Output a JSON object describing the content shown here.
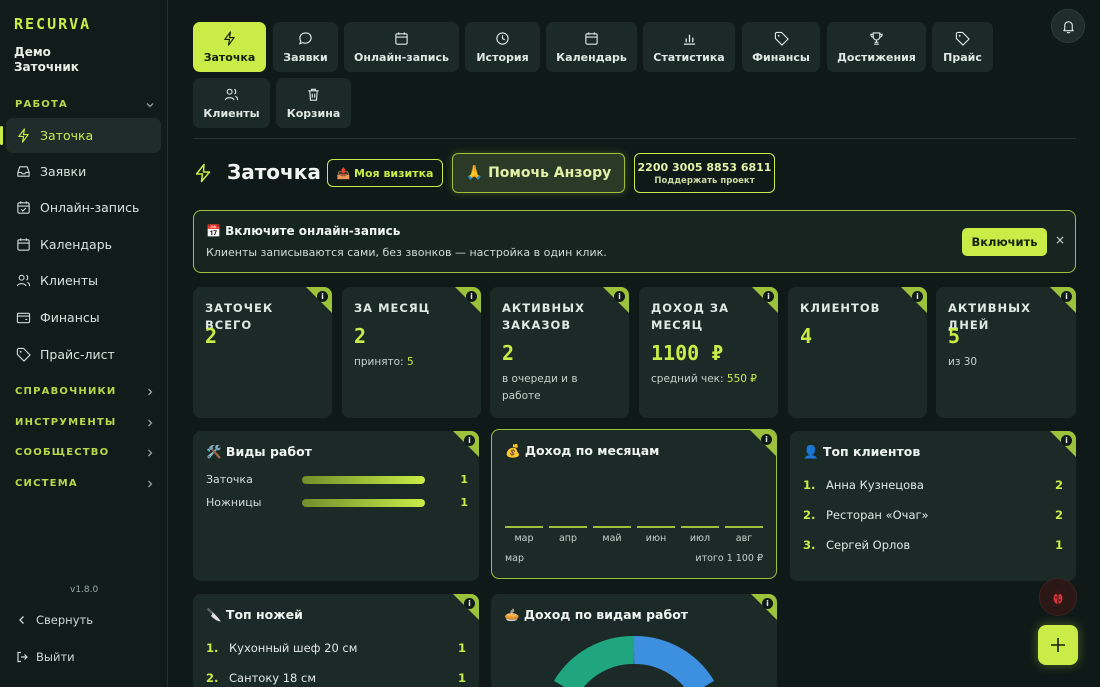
{
  "app": {
    "logo": "RECURVA",
    "user_line1": "Демо",
    "user_line2": "Заточник",
    "version": "v1.8.0"
  },
  "sidebar": {
    "section_work": "РАБОТА",
    "items": [
      {
        "label": "Заточка",
        "icon": "bolt-icon"
      },
      {
        "label": "Заявки",
        "icon": "inbox-icon"
      },
      {
        "label": "Онлайн-запись",
        "icon": "calendar-check-icon"
      },
      {
        "label": "Календарь",
        "icon": "calendar-icon"
      },
      {
        "label": "Клиенты",
        "icon": "users-icon"
      },
      {
        "label": "Финансы",
        "icon": "wallet-icon"
      },
      {
        "label": "Прайс-лист",
        "icon": "tag-icon"
      }
    ],
    "sections": [
      "СПРАВОЧНИКИ",
      "ИНСТРУМЕНТЫ",
      "СООБЩЕСТВО",
      "СИСТЕМА"
    ],
    "collapse": "Свернуть",
    "logout": "Выйти"
  },
  "tabs": [
    {
      "label": "Заточка",
      "icon": "bolt-icon"
    },
    {
      "label": "Заявки",
      "icon": "chat-icon"
    },
    {
      "label": "Онлайн-запись",
      "icon": "calendar-icon"
    },
    {
      "label": "История",
      "icon": "clock-icon"
    },
    {
      "label": "Календарь",
      "icon": "calendar-icon"
    },
    {
      "label": "Статистика",
      "icon": "bar-chart-icon"
    },
    {
      "label": "Финансы",
      "icon": "tag-icon"
    },
    {
      "label": "Достижения",
      "icon": "trophy-icon"
    },
    {
      "label": "Прайс",
      "icon": "tag-icon"
    },
    {
      "label": "Клиенты",
      "icon": "users-icon"
    },
    {
      "label": "Корзина",
      "icon": "trash-icon"
    }
  ],
  "header": {
    "title": "Заточка",
    "card_btn": "📤 Моя визитка",
    "help_btn": "🙏 Помочь Анзору",
    "support_number": "2200 3005 8853 6811",
    "support_label": "Поддержать проект"
  },
  "banner": {
    "title": "📅 Включите онлайн-запись",
    "text": "Клиенты записываются сами, без звонков — настройка в один клик.",
    "button": "Включить",
    "close": "×"
  },
  "stats": [
    {
      "label": "ЗАТОЧЕК ВСЕГО",
      "value": "2",
      "sub_text": "",
      "sub_value": ""
    },
    {
      "label": "ЗА МЕСЯЦ",
      "value": "2",
      "sub_text": "принято: ",
      "sub_value": "5"
    },
    {
      "label": "АКТИВНЫХ ЗАКАЗОВ",
      "value": "2",
      "sub_text": "в очереди и в работе",
      "sub_value": ""
    },
    {
      "label": "ДОХОД ЗА МЕСЯЦ",
      "value": "1100 ₽",
      "sub_text": "средний чек: ",
      "sub_value": "550 ₽"
    },
    {
      "label": "КЛИЕНТОВ",
      "value": "4",
      "sub_text": "",
      "sub_value": ""
    },
    {
      "label": "АКТИВНЫХ ДНЕЙ",
      "value": "5",
      "sub_text": "из 30",
      "sub_value": ""
    }
  ],
  "work_types": {
    "title": "🛠️ Виды работ",
    "rows": [
      {
        "name": "Заточка",
        "count": "1",
        "share": 1.0
      },
      {
        "name": "Ножницы",
        "count": "1",
        "share": 1.0
      }
    ]
  },
  "income_month": {
    "title": "💰 Доход по месяцам",
    "months": [
      "мар",
      "апр",
      "май",
      "июн",
      "июл",
      "авг"
    ],
    "footer_left": "мар",
    "footer_right": "итого 1 100 ₽"
  },
  "top_clients": {
    "title": "👤 Топ клиентов",
    "rows": [
      {
        "num": "1.",
        "name": "Анна Кузнецова",
        "count": "2"
      },
      {
        "num": "2.",
        "name": "Ресторан «Очаг»",
        "count": "2"
      },
      {
        "num": "3.",
        "name": "Сергей Орлов",
        "count": "1"
      }
    ]
  },
  "top_knives": {
    "title": "🔪 Топ ножей",
    "rows": [
      {
        "num": "1.",
        "name": "Кухонный шеф 20 см",
        "count": "1"
      },
      {
        "num": "2.",
        "name": "Сантоку 18 см",
        "count": "1"
      }
    ]
  },
  "income_types": {
    "title": "🥧 Доход по видам работ"
  },
  "colors": {
    "accent": "#c9ec47",
    "bg": "#0f1a18",
    "card": "#1c2a27"
  }
}
